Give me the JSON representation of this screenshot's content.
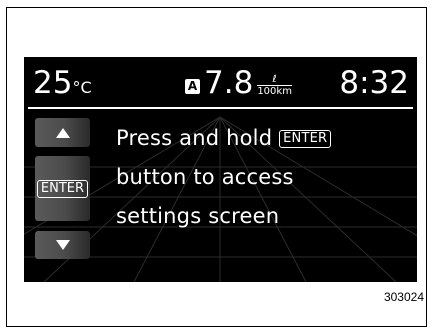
{
  "display": {
    "temperature": "25",
    "temperature_unit": "°C",
    "mode_badge": "A",
    "fuel_value": "7.8",
    "fuel_unit_top": "ℓ",
    "fuel_unit_bottom": "100km",
    "clock": "8:32"
  },
  "side_buttons": {
    "up_icon": "triangle-up-icon",
    "enter_label": "ENTER",
    "down_icon": "triangle-down-icon"
  },
  "message": {
    "line1_prefix": "Press and hold ",
    "line1_key": "ENTER",
    "line2": "button to access",
    "line3": "settings screen"
  },
  "figure_number": "303024"
}
